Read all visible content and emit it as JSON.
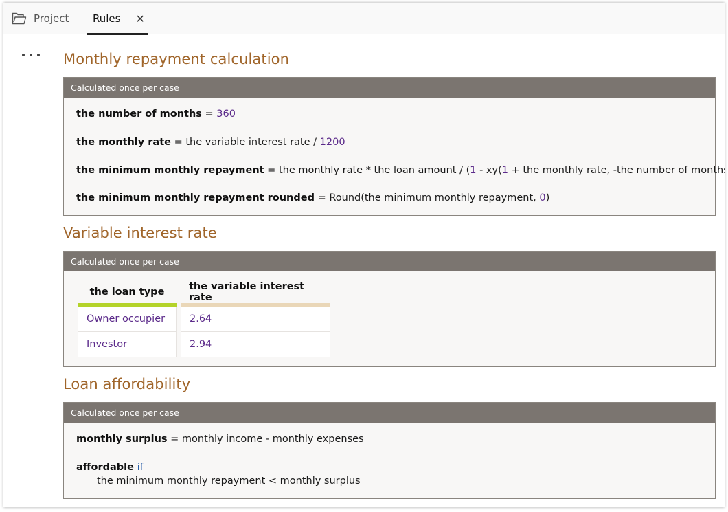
{
  "tabs": {
    "project": "Project",
    "rules": "Rules",
    "close_glyph": "✕"
  },
  "sections": {
    "monthly": {
      "title": "Monthly repayment calculation",
      "header": "Calculated once per case",
      "r1_attr": "the number of months",
      "r1_eq": " = ",
      "r1_val": "360",
      "r2_attr": "the monthly rate",
      "r2_expr": " = the variable interest rate / ",
      "r2_num": "1200",
      "r3_attr": "the minimum monthly repayment",
      "r3_expr_a": " = the monthly rate * the loan amount / (",
      "r3_num1": "1",
      "r3_expr_b": " - xy(",
      "r3_num2": "1",
      "r3_expr_c": " + the monthly rate, -the number of months))",
      "r4_attr": "the minimum monthly repayment rounded",
      "r4_expr": " = Round(the minimum monthly repayment, ",
      "r4_num": "0",
      "r4_end": ")"
    },
    "variable": {
      "title": "Variable interest rate",
      "header": "Calculated once per case",
      "table": {
        "headers": [
          "the loan type",
          "the variable interest rate"
        ],
        "rows": [
          [
            "Owner occupier",
            "2.64"
          ],
          [
            "Investor",
            "2.94"
          ]
        ]
      }
    },
    "afford": {
      "title": "Loan affordability",
      "header": "Calculated once per case",
      "r1_attr": "monthly surplus",
      "r1_expr": " = monthly income - monthly expenses",
      "r2_attr": "affordable",
      "r2_kw": " if",
      "r2_cond": "the minimum monthly repayment < monthly surplus"
    }
  },
  "colors": {
    "section_title": "#a0652a",
    "card_header": "#7b7570",
    "condition_bar": "#b4d32a",
    "conclusion_bar": "#ead7b8",
    "number": "#5b2a8a"
  }
}
